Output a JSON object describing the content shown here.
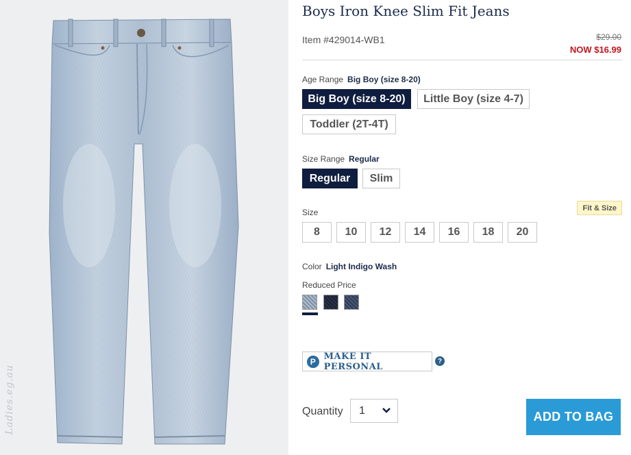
{
  "product": {
    "title": "Boys Iron Knee Slim Fit Jeans",
    "item_number": "Item #429014-WB1",
    "original_price": "$29.00",
    "sale_price": "NOW $16.99",
    "image_alt": "jeans-product-image",
    "watermark": "Ladies.eg.au"
  },
  "age_range": {
    "label": "Age Range",
    "selected": "Big Boy (size 8-20)",
    "options": [
      "Big Boy (size 8-20)",
      "Little Boy (size 4-7)",
      "Toddler (2T-4T)"
    ]
  },
  "size_range": {
    "label": "Size Range",
    "selected": "Regular",
    "options": [
      "Regular",
      "Slim"
    ]
  },
  "size": {
    "label": "Size",
    "fit_link": "Fit & Size",
    "options": [
      "8",
      "10",
      "12",
      "14",
      "16",
      "18",
      "20"
    ]
  },
  "color": {
    "label": "Color",
    "selected": "Light Indigo Wash",
    "sub_label": "Reduced Price",
    "swatches": [
      "Light Indigo Wash",
      "Dark wash",
      "Medium dark wash"
    ]
  },
  "personalize": {
    "icon_letter": "P",
    "label": "MAKE IT PERSONAL",
    "help": "?"
  },
  "quantity": {
    "label": "Quantity",
    "value": "1"
  },
  "cta": {
    "add_to_bag": "ADD TO BAG"
  },
  "colors": {
    "navy": "#0f1d3f",
    "sale_red": "#c3161c",
    "cta_blue": "#2a9bd6"
  }
}
